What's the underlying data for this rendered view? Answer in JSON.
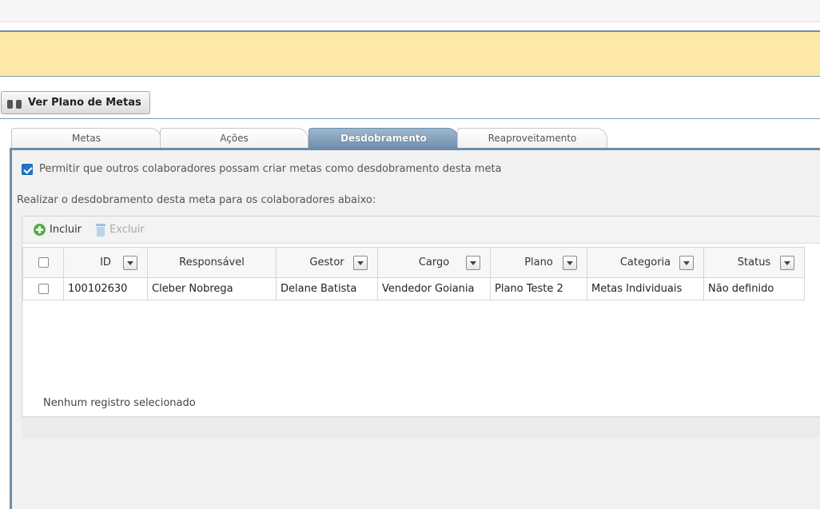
{
  "header": {
    "plan_button_label": "Ver Plano de Metas",
    "plan_button_icon": "binoculars-icon"
  },
  "tabs": [
    {
      "label": "Metas",
      "active": false
    },
    {
      "label": "Ações",
      "active": false
    },
    {
      "label": "Desdobramento",
      "active": true
    },
    {
      "label": "Reaproveitamento",
      "active": false
    }
  ],
  "panel": {
    "allow_checkbox_checked": true,
    "allow_label": "Permitir que outros colaboradores possam criar metas como desdobramento desta meta",
    "instruction": "Realizar o desdobramento desta meta para os colaboradores abaixo:"
  },
  "toolbar": {
    "add_label": "Incluir",
    "add_icon": "plus-circle-icon",
    "delete_label": "Excluir",
    "delete_icon": "trash-icon",
    "delete_disabled": true
  },
  "grid": {
    "columns": [
      "ID",
      "Responsável",
      "Gestor",
      "Cargo",
      "Plano",
      "Categoria",
      "Status"
    ],
    "rows": [
      {
        "selected": false,
        "cells": [
          "100102630",
          "Cleber Nobrega",
          "Delane Batista",
          "Vendedor Goiania",
          "Plano Teste 2",
          "Metas Individuais",
          "Não definido"
        ]
      }
    ],
    "status_text": "Nenhum registro selecionado"
  },
  "colors": {
    "banner": "#fde8a8",
    "tab_active": "#6d8eab",
    "panel_border": "#6f8ca5",
    "checkbox_checked": "#1f75ce",
    "add_icon": "#4fae3c"
  }
}
